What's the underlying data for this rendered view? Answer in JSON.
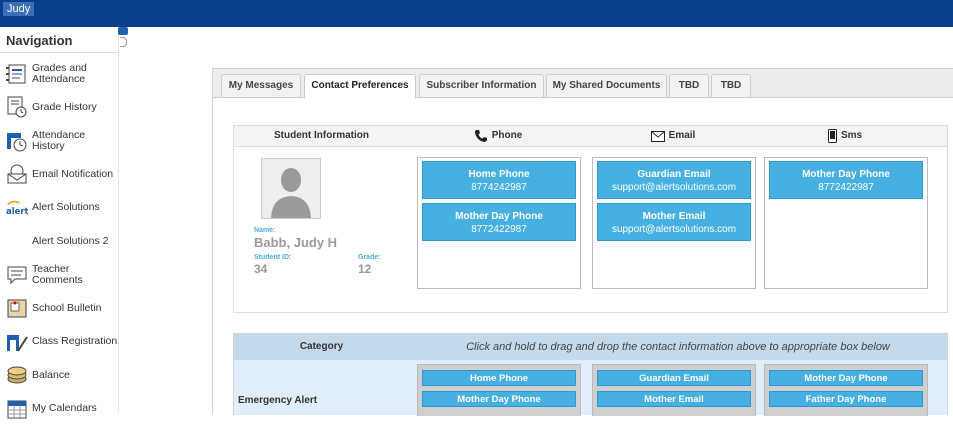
{
  "user": {
    "name": "Judy"
  },
  "sidebar": {
    "title": "Navigation",
    "items": [
      {
        "label": "Grades and Attendance",
        "icon": "gradebook-icon"
      },
      {
        "label": "Grade History",
        "icon": "grade-history-icon"
      },
      {
        "label": "Attendance History",
        "icon": "attendance-history-icon"
      },
      {
        "label": "Email Notification",
        "icon": "email-notification-icon"
      },
      {
        "label": "Alert Solutions",
        "icon": "alert-logo-icon"
      },
      {
        "label": "Alert Solutions 2",
        "icon": ""
      },
      {
        "label": "Teacher Comments",
        "icon": "speech-bubble-icon"
      },
      {
        "label": "School Bulletin",
        "icon": "bulletin-board-icon"
      },
      {
        "label": "Class Registration",
        "icon": "class-registration-icon"
      },
      {
        "label": "Balance",
        "icon": "coins-icon"
      },
      {
        "label": "My Calendars",
        "icon": "calendar-icon"
      }
    ]
  },
  "tabs": [
    {
      "label": "My Messages",
      "active": false
    },
    {
      "label": "Contact Preferences",
      "active": true
    },
    {
      "label": "Subscriber Information",
      "active": false
    },
    {
      "label": "My Shared Documents",
      "active": false
    },
    {
      "label": "TBD",
      "active": false
    },
    {
      "label": "TBD",
      "active": false
    }
  ],
  "contact": {
    "columns": {
      "student": "Student Information",
      "phone": "Phone",
      "email": "Email",
      "sms": "Sms"
    },
    "student": {
      "name_label": "Name:",
      "name": "Babb, Judy H",
      "id_label": "Student ID:",
      "id": "34",
      "grade_label": "Grade:",
      "grade": "12"
    },
    "phone": [
      {
        "title": "Home Phone",
        "value": "8774242987"
      },
      {
        "title": "Mother Day Phone",
        "value": "8772422987"
      }
    ],
    "email": [
      {
        "title": "Guardian Email",
        "value": "support@alertsolutions.com"
      },
      {
        "title": "Mother Email",
        "value": "support@alertsolutions.com"
      }
    ],
    "sms": [
      {
        "title": "Mother Day Phone",
        "value": "8772422987"
      }
    ]
  },
  "category": {
    "header": "Category",
    "hint": "Click and hold to drag and drop the contact information above to appropriate box below",
    "rows": [
      {
        "label": "Emergency Alert",
        "phone": [
          "Home Phone",
          "Mother Day Phone"
        ],
        "email": [
          "Guardian Email",
          "Mother Email"
        ],
        "sms": [
          "Mother Day Phone",
          "Father Day Phone"
        ]
      }
    ]
  },
  "colors": {
    "topbar": "#0a3f8c",
    "pill": "#46b0e3",
    "category_header": "#c4d9ea",
    "category_row": "#dfeefa"
  }
}
